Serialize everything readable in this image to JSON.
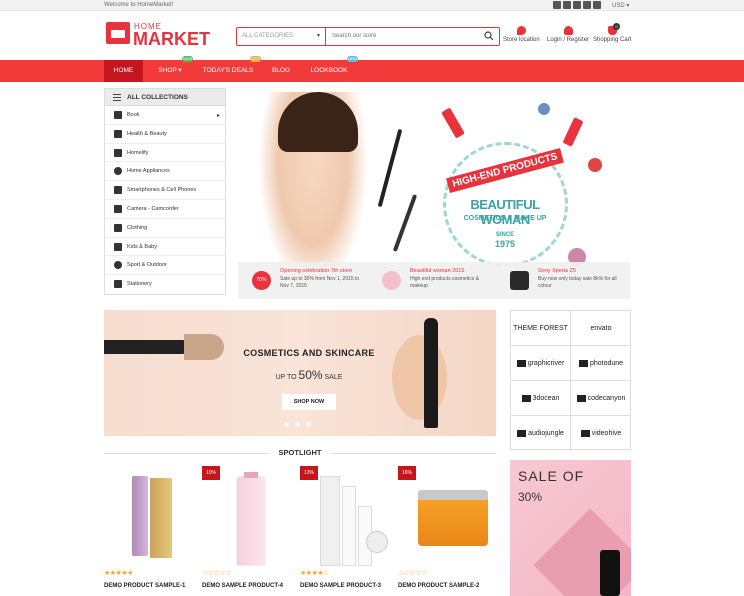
{
  "topbar": {
    "welcome": "Welcome to HomeMarket!",
    "currency": "USD"
  },
  "logo": {
    "top": "HOME",
    "main": "MARKET"
  },
  "search": {
    "category": "ALL CATEGORIES",
    "placeholder": "Search our store"
  },
  "header_links": [
    {
      "label": "Store location",
      "icon": "map-pin-icon"
    },
    {
      "label": "Login / Register",
      "icon": "user-icon"
    },
    {
      "label": "Shopping Cart",
      "icon": "cart-icon",
      "count": "0"
    }
  ],
  "nav": {
    "items": [
      "HOME",
      "SHOP",
      "TODAY'S DEALS",
      "BLOG",
      "LOOKBOOK"
    ],
    "badges": {
      "shop": "NEW",
      "deals": "HOT",
      "lookbook": "NEW"
    },
    "colors": {
      "bar": "#f23a3a",
      "active": "#c4161c"
    }
  },
  "sidebar": {
    "title": "ALL COLLECTIONS",
    "items": [
      "Book",
      "Health & Beauty",
      "Homelify",
      "Home Appliances",
      "Smartphones & Cell Phones",
      "Camera - Camcorder",
      "Clothing",
      "Kids & Baby",
      "Sport & Outdoor",
      "Stationery"
    ]
  },
  "hero": {
    "line1": "HIGH-END PRODUCTS",
    "line2": "BEAUTIFUL WOMAN",
    "line3": "COSMETICS & MAKE UP",
    "since": "SINCE",
    "year": "1975"
  },
  "promos": [
    {
      "title": "Opening celebration 7th store",
      "desc": "Sale up to 30% from Nov 1, 2015 to Nov 7, 2015",
      "badge": "70%"
    },
    {
      "title": "Beautiful woman 2015",
      "desc": "High end products cosmetics & makeup"
    },
    {
      "title": "Sony Xperia Z5",
      "desc": "Buy now only today sale 8k% for all colour"
    }
  ],
  "banner": {
    "title": "COSMETICS AND SKINCARE",
    "pre": "UP TO",
    "pct": "50%",
    "post": "SALE",
    "button": "SHOP NOW"
  },
  "brands": [
    "THEME FOREST",
    "envato",
    "graphicriver",
    "photodune",
    "3docean",
    "codecanyon",
    "audiojungle",
    "videohive"
  ],
  "spotlight": {
    "title": "SPOTLIGHT",
    "products": [
      {
        "name": "DEMO PRODUCT SAMPLE-1",
        "discount": "",
        "rating": 5
      },
      {
        "name": "DEMO SAMPLE PRODUCT-4",
        "discount": "10%",
        "rating": 0
      },
      {
        "name": "DEMO SAMPLE PRODUCT-3",
        "discount": "13%",
        "rating": 4
      },
      {
        "name": "DEMO PRODUCT SAMPLE-2",
        "discount": "16%",
        "rating": 0
      }
    ]
  },
  "sale_box": {
    "title": "SALE OF",
    "pct": "30%"
  }
}
